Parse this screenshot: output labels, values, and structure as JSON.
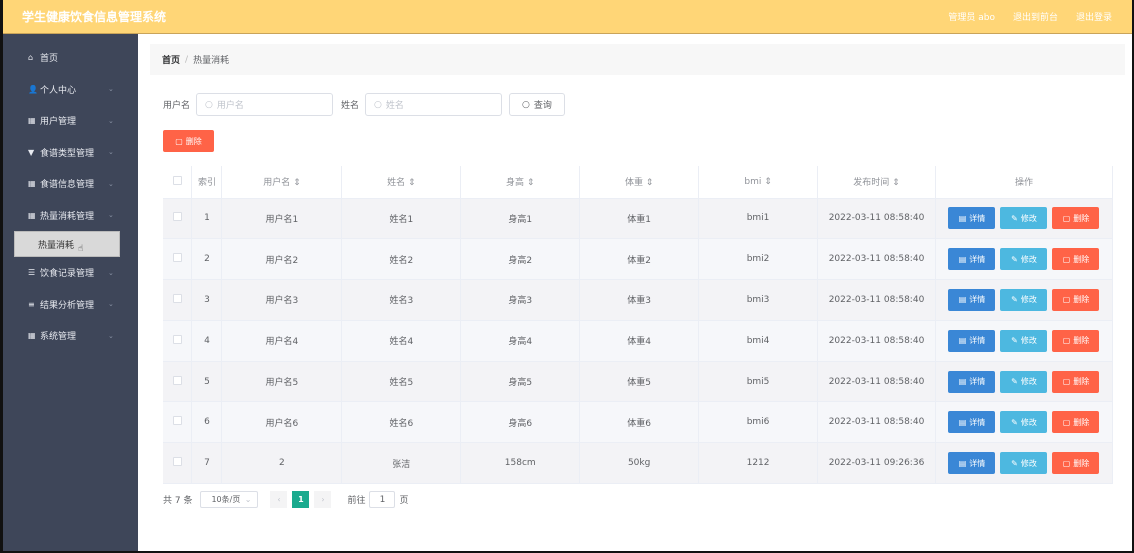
{
  "header": {
    "title": "学生健康饮食信息管理系统",
    "user": "管理员 abo",
    "front": "退出到前台",
    "logout": "退出登录"
  },
  "sidebar": {
    "items": [
      {
        "icon": "home-icon",
        "glyph": "⌂",
        "label": "首页",
        "chev": false
      },
      {
        "icon": "user-icon",
        "glyph": "👤",
        "label": "个人中心",
        "chev": true
      },
      {
        "icon": "grid-icon",
        "glyph": "▦",
        "label": "用户管理",
        "chev": true
      },
      {
        "icon": "cup-icon",
        "glyph": "▼",
        "label": "食谱类型管理",
        "chev": true
      },
      {
        "icon": "grid-icon",
        "glyph": "▦",
        "label": "食谱信息管理",
        "chev": true
      },
      {
        "icon": "grid-icon",
        "glyph": "▦",
        "label": "热量消耗管理",
        "chev": true
      },
      {
        "icon": "sliders-icon",
        "glyph": "☰",
        "label": "饮食记录管理",
        "chev": true
      },
      {
        "icon": "menu-icon",
        "glyph": "≡",
        "label": "结果分析管理",
        "chev": true
      },
      {
        "icon": "grid-icon",
        "glyph": "▦",
        "label": "系统管理",
        "chev": true
      }
    ],
    "active_sub": "热量消耗"
  },
  "breadcrumb": {
    "home": "首页",
    "sep": "/",
    "current": "热量消耗"
  },
  "search": {
    "username_label": "用户名",
    "username_placeholder": "用户名",
    "name_label": "姓名",
    "name_placeholder": "姓名",
    "query": "查询"
  },
  "delete_label": "删除",
  "table": {
    "headers": [
      "索引",
      "用户名 ⇕",
      "姓名 ⇕",
      "身高 ⇕",
      "体重 ⇕",
      "bmi ⇕",
      "发布时间 ⇕",
      "操作"
    ],
    "rows": [
      [
        "1",
        "用户名1",
        "姓名1",
        "身高1",
        "体重1",
        "bmi1",
        "2022-03-11 08:58:40"
      ],
      [
        "2",
        "用户名2",
        "姓名2",
        "身高2",
        "体重2",
        "bmi2",
        "2022-03-11 08:58:40"
      ],
      [
        "3",
        "用户名3",
        "姓名3",
        "身高3",
        "体重3",
        "bmi3",
        "2022-03-11 08:58:40"
      ],
      [
        "4",
        "用户名4",
        "姓名4",
        "身高4",
        "体重4",
        "bmi4",
        "2022-03-11 08:58:40"
      ],
      [
        "5",
        "用户名5",
        "姓名5",
        "身高5",
        "体重5",
        "bmi5",
        "2022-03-11 08:58:40"
      ],
      [
        "6",
        "用户名6",
        "姓名6",
        "身高6",
        "体重6",
        "bmi6",
        "2022-03-11 08:58:40"
      ],
      [
        "7",
        "2",
        "张洁",
        "158cm",
        "50kg",
        "1212",
        "2022-03-11 09:26:36"
      ]
    ],
    "actions": {
      "detail": "详情",
      "edit": "修改",
      "delete": "删除"
    }
  },
  "colors": {
    "detail": "#3a87d6",
    "edit": "#4db8e0",
    "delete": "#ff6347",
    "header": "#ffd677",
    "sidebar": "#3e4659",
    "page_active": "#1aaa8e"
  },
  "pagination": {
    "total": "共 7 条",
    "page_size": "10条/页",
    "current": "1",
    "goto": "前往",
    "goto_value": "1",
    "page_suffix": "页"
  }
}
